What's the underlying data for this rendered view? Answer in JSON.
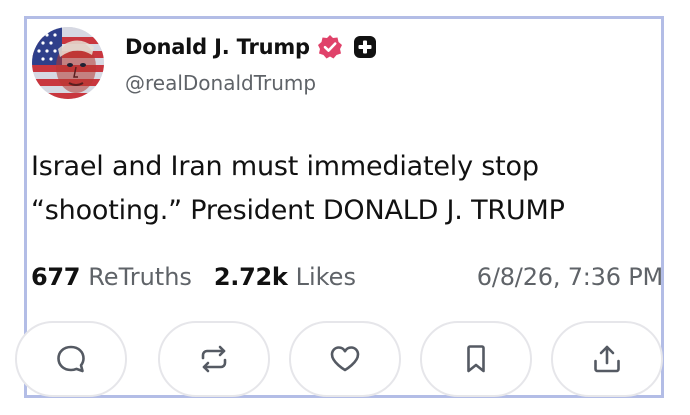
{
  "author": {
    "display_name": "Donald J. Trump",
    "handle": "@realDonaldTrump",
    "avatar_icon": "flag-portrait-avatar",
    "verified_icon": "verified-badge-icon",
    "verified_color": "#e0426a",
    "plus_icon": "plus-badge-icon"
  },
  "post": {
    "lines": [
      "Israel and Iran must immediately stop",
      "“shooting.” President DONALD J. TRUMP"
    ]
  },
  "stats": {
    "retruths_count": "677",
    "retruths_label": "ReTruths",
    "likes_count": "2.72k",
    "likes_label": "Likes",
    "timestamp": "6/8/26, 7:36 PM"
  },
  "actions": [
    {
      "name": "reply",
      "icon": "comment-bubble-icon"
    },
    {
      "name": "retruth",
      "icon": "repost-arrows-icon"
    },
    {
      "name": "like",
      "icon": "heart-icon"
    },
    {
      "name": "bookmark",
      "icon": "bookmark-icon"
    },
    {
      "name": "share",
      "icon": "share-upload-icon"
    }
  ],
  "colors": {
    "frame_border": "#b3bde6",
    "secondary_text": "#5f6368",
    "button_border": "#e6e6ea",
    "icon_stroke": "#555a63"
  }
}
